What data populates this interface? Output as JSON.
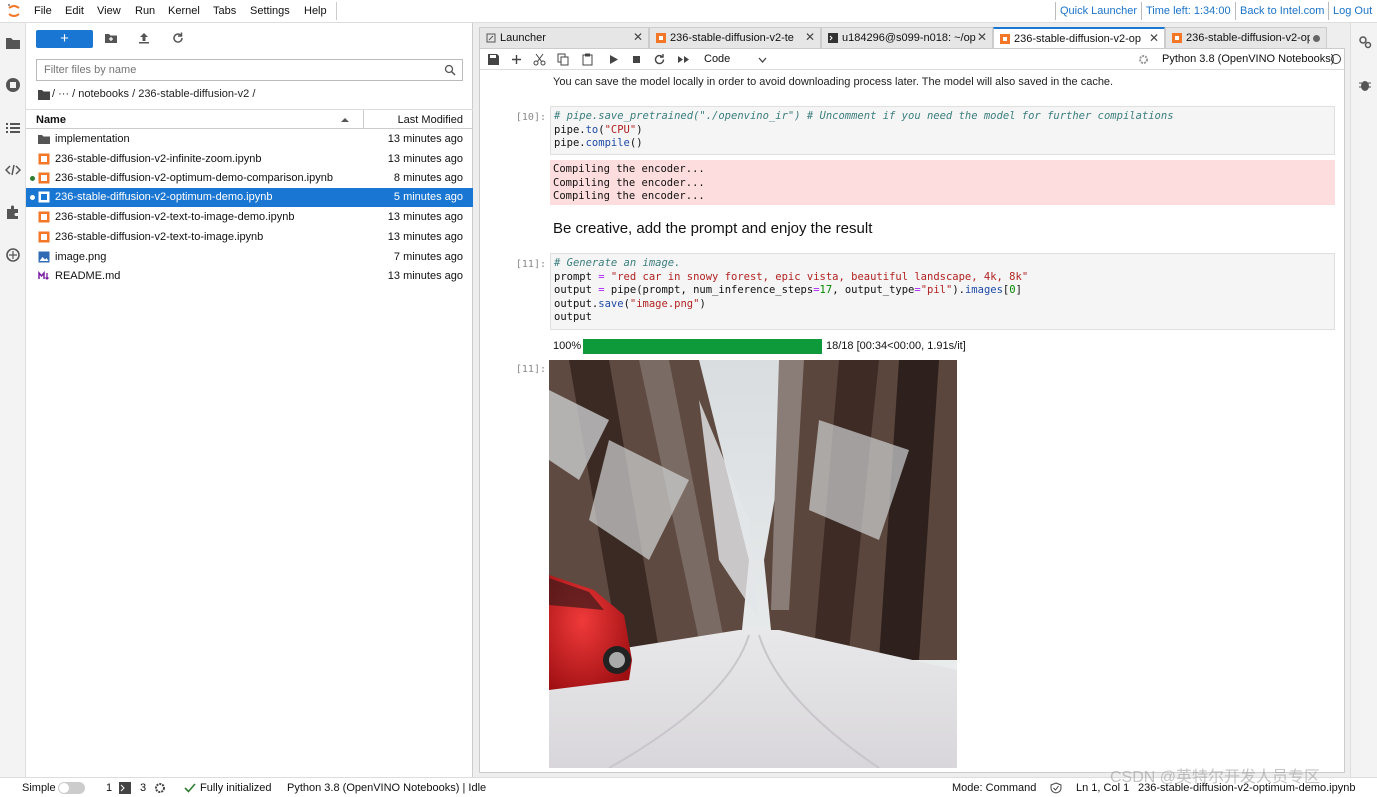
{
  "menubar": {
    "items": [
      "File",
      "Edit",
      "View",
      "Run",
      "Kernel",
      "Tabs",
      "Settings",
      "Help"
    ],
    "links": [
      "Quick Launcher",
      "Time left: 1:34:00",
      "Back to Intel.com",
      "Log Out"
    ]
  },
  "filebrowser": {
    "new_label": "+",
    "filter_placeholder": "Filter files by name",
    "breadcrumb": "/   ···   / notebooks / 236-stable-diffusion-v2 /",
    "col_name": "Name",
    "col_modified": "Last Modified",
    "files": [
      {
        "name": "implementation",
        "modified": "13 minutes ago",
        "type": "folder"
      },
      {
        "name": "236-stable-diffusion-v2-infinite-zoom.ipynb",
        "modified": "13 minutes ago",
        "type": "notebook"
      },
      {
        "name": "236-stable-diffusion-v2-optimum-demo-comparison.ipynb",
        "modified": "8 minutes ago",
        "type": "notebook",
        "running": true
      },
      {
        "name": "236-stable-diffusion-v2-optimum-demo.ipynb",
        "modified": "5 minutes ago",
        "type": "notebook",
        "running": true,
        "selected": true
      },
      {
        "name": "236-stable-diffusion-v2-text-to-image-demo.ipynb",
        "modified": "13 minutes ago",
        "type": "notebook"
      },
      {
        "name": "236-stable-diffusion-v2-text-to-image.ipynb",
        "modified": "13 minutes ago",
        "type": "notebook"
      },
      {
        "name": "image.png",
        "modified": "7 minutes ago",
        "type": "image"
      },
      {
        "name": "README.md",
        "modified": "13 minutes ago",
        "type": "markdown"
      }
    ]
  },
  "tabs": [
    {
      "label": "Launcher",
      "icon": "launcher-icon"
    },
    {
      "label": "236-stable-diffusion-v2-te",
      "icon": "notebook-icon"
    },
    {
      "label": "u184296@s099-n018: ~/op",
      "icon": "terminal-icon"
    },
    {
      "label": "236-stable-diffusion-v2-op",
      "icon": "notebook-icon",
      "active": true
    },
    {
      "label": "236-stable-diffusion-v2-op",
      "icon": "notebook-icon",
      "dirty": true
    }
  ],
  "notebook": {
    "cell_type": "Code",
    "kernel": "Python 3.8 (OpenVINO Notebooks)",
    "md_save": "You can save the model locally in order to avoid downloading process later. The model will also saved in the cache.",
    "cell10_prompt": "[10]:",
    "cell10_comment": "# pipe.save_pretrained(\"./openvino_ir\") # Uncomment if you need the model for further compilations",
    "cell10_line2_a": "pipe.",
    "cell10_line2_b": "to",
    "cell10_line2_c": "(",
    "cell10_line2_d": "\"CPU\"",
    "cell10_line2_e": ")",
    "cell10_line3_a": "pipe.",
    "cell10_line3_b": "compile",
    "cell10_line3_c": "()",
    "stderr": "Compiling the encoder...\nCompiling the encoder...\nCompiling the encoder...",
    "heading": "Be creative, add the prompt and enjoy the result",
    "cell11_prompt": "[11]:",
    "cell11_comment": "# Generate an image.",
    "cell11_l2_a": "prompt ",
    "cell11_l2_b": "=",
    "cell11_l2_c": " \"red car in snowy forest, epic vista, beautiful landscape, 4k, 8k\"",
    "cell11_l3_a": "output ",
    "cell11_l3_b": "=",
    "cell11_l3_c": " pipe(prompt, num_inference_steps",
    "cell11_l3_d": "=",
    "cell11_l3_e": "17",
    "cell11_l3_f": ", output_type",
    "cell11_l3_g": "=",
    "cell11_l3_h": "\"pil\"",
    "cell11_l3_i": ").",
    "cell11_l3_j": "images",
    "cell11_l3_k": "[",
    "cell11_l3_l": "0",
    "cell11_l3_m": "]",
    "cell11_l4_a": "output.",
    "cell11_l4_b": "save",
    "cell11_l4_c": "(",
    "cell11_l4_d": "\"image.png\"",
    "cell11_l4_e": ")",
    "cell11_l5": "output",
    "progress_label": "100%",
    "progress_fraction": 1.0,
    "progress_stats": "18/18 [00:34<00:00, 1.91s/it]",
    "out11_prompt": "[11]:"
  },
  "statusbar": {
    "mode_label": "Simple",
    "terminals": "1",
    "kernels": "3",
    "init": "Fully initialized",
    "kernel_status": "Python 3.8 (OpenVINO Notebooks) | Idle",
    "mode": "Mode: Command",
    "position": "Ln 1, Col 1",
    "filename": "236-stable-diffusion-v2-optimum-demo.ipynb"
  },
  "watermark": "CSDN @英特尔开发人员专区",
  "colors": {
    "accent": "#1976d2",
    "progress": "#0e9a3a",
    "stderr_bg": "#fddddd"
  }
}
